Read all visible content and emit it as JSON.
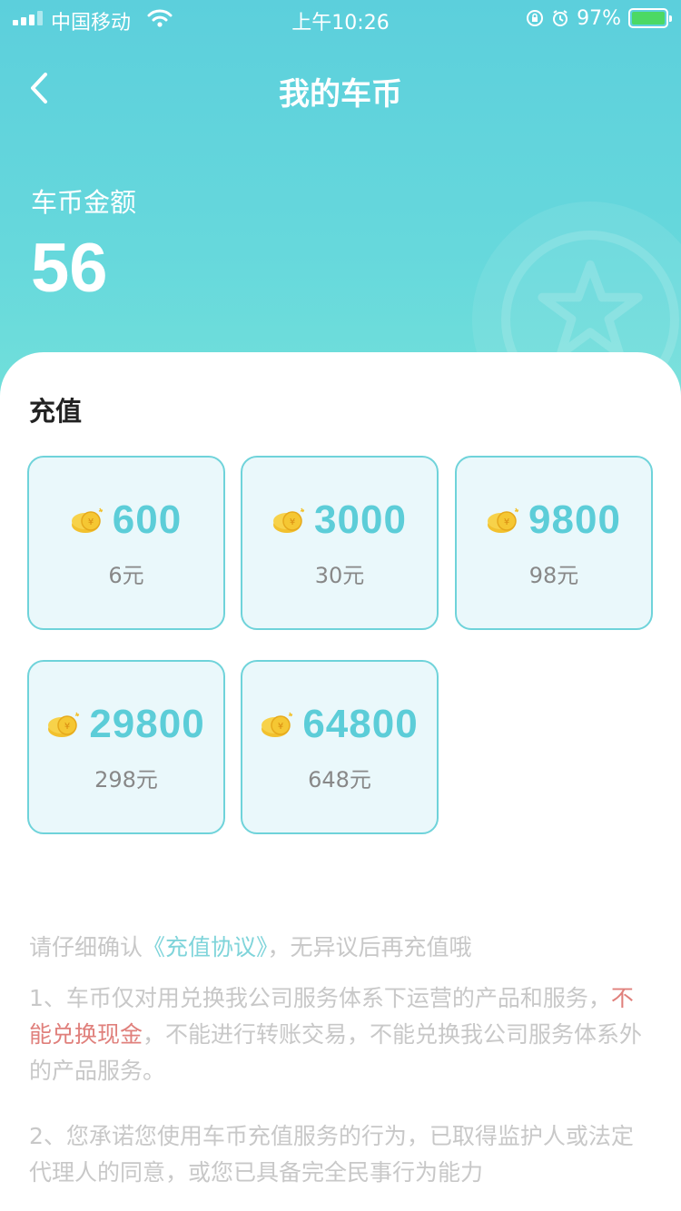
{
  "status_bar": {
    "carrier": "中国移动",
    "time": "上午10:26",
    "battery": "97%"
  },
  "nav": {
    "title": "我的车币"
  },
  "balance": {
    "label": "车币金额",
    "value": "56"
  },
  "recharge": {
    "title": "充值",
    "packages": [
      {
        "coins": "600",
        "price": "6元"
      },
      {
        "coins": "3000",
        "price": "30元"
      },
      {
        "coins": "9800",
        "price": "98元"
      },
      {
        "coins": "29800",
        "price": "298元"
      },
      {
        "coins": "64800",
        "price": "648元"
      }
    ]
  },
  "notice": {
    "confirm_prefix": "请仔细确认",
    "agreement_link": "《充值协议》",
    "confirm_suffix": "，无异议后再充值哦",
    "item1_part1": "1、车币仅对用兑换我公司服务体系下运营的产品和服务，",
    "item1_warn": "不能兑换现金",
    "item1_part2": "，不能进行转账交易，不能兑换我公司服务体系外的产品服务。",
    "item2": "2、您承诺您使用车币充值服务的行为，已取得监护人或法定代理人的同意，或您已具备完全民事行为能力"
  },
  "colors": {
    "header": "#5ccfdc",
    "accent": "#5ccdd8",
    "card_bg": "#eaf8fb",
    "warning": "#e0807c"
  },
  "icons": {
    "back": "chevron-left-icon",
    "coin": "coin-stack-icon"
  }
}
